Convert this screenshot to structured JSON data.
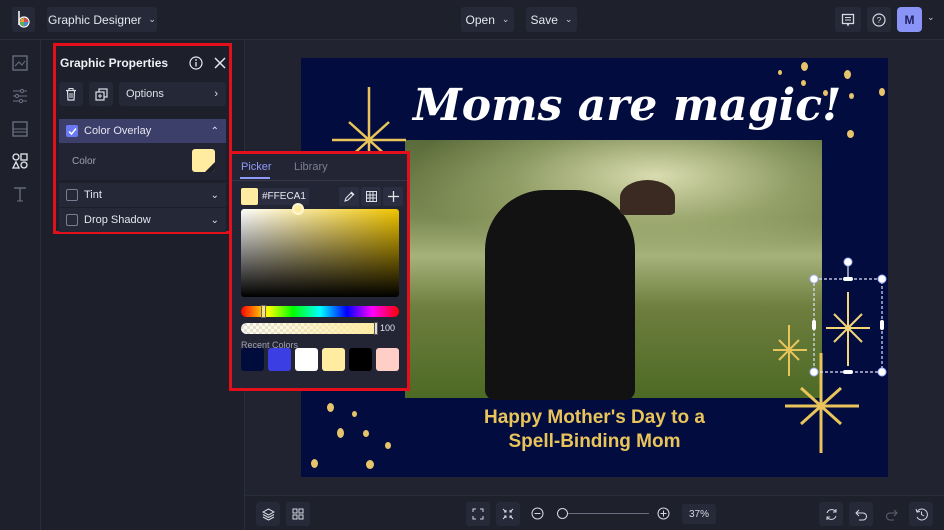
{
  "topbar": {
    "app_menu_label": "Graphic Designer",
    "open_label": "Open",
    "save_label": "Save",
    "avatar_initial": "M"
  },
  "left_rail": {
    "items": [
      "image-icon",
      "adjust-icon",
      "layout-icon",
      "shapes-icon",
      "text-icon"
    ],
    "active": "shapes-icon"
  },
  "graphic_properties": {
    "title": "Graphic Properties",
    "options_label": "Options",
    "sections": [
      {
        "label": "Color Overlay",
        "checked": true,
        "expanded": true
      },
      {
        "label": "Tint",
        "checked": false,
        "expanded": false
      },
      {
        "label": "Drop Shadow",
        "checked": false,
        "expanded": false
      }
    ],
    "color_label": "Color",
    "color_value": "#FFECA1"
  },
  "color_picker": {
    "tabs": [
      "Picker",
      "Library"
    ],
    "active_tab": "Picker",
    "hex_value": "#FFECA1",
    "opacity": "100",
    "recent_label": "Recent Colors",
    "recent_colors": [
      "#000c3c",
      "#3b3fe3",
      "#ffffff",
      "#ffeca1",
      "#000000",
      "#ffcfc7"
    ]
  },
  "canvas": {
    "headline": "Moms are magic!",
    "subline_1": "Happy Mother's Day to a",
    "subline_2": "Spell-Binding Mom",
    "background_color": "#020c3f",
    "accent_color": "#e8c45a"
  },
  "bottombar": {
    "zoom_label": "37%",
    "zoom_percent": 37
  },
  "colors": {
    "highlight_border": "#e3101b",
    "accent": "#6a78f4"
  }
}
